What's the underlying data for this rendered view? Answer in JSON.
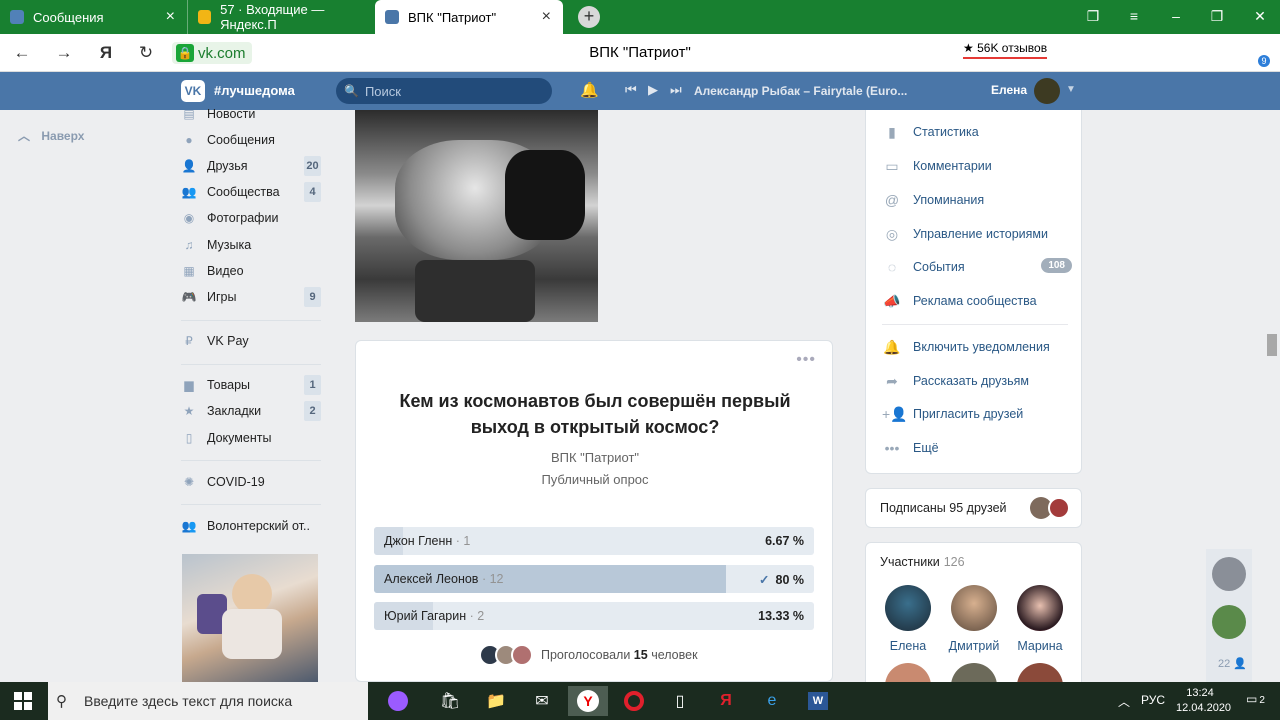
{
  "browser": {
    "tabs": [
      {
        "label": "Сообщения",
        "icon": "vk-messages-icon"
      },
      {
        "label": "57 · Входящие — Яндекс.П",
        "icon": "yandex-mail-icon"
      },
      {
        "label": "ВПК \"Патриот\"",
        "icon": "vk-icon"
      }
    ],
    "new_tab": "+",
    "url": "vk.com",
    "page_title": "ВПК \"Патриот\"",
    "reviews": "★ 56K отзывов",
    "yandex_glyph": "Я",
    "badge_downloads": "9"
  },
  "vk": {
    "hashtag": "#лучшедома",
    "search_placeholder": "Поиск",
    "track": "Александр Рыбак – Fairytale (Euro...",
    "user_name": "Елена",
    "back_to_top": "Наверх"
  },
  "left_nav": [
    {
      "label": "Новости",
      "icon": "news-icon",
      "count": ""
    },
    {
      "label": "Сообщения",
      "icon": "messages-icon",
      "count": ""
    },
    {
      "label": "Друзья",
      "icon": "friends-icon",
      "count": "20"
    },
    {
      "label": "Сообщества",
      "icon": "communities-icon",
      "count": "4"
    },
    {
      "label": "Фотографии",
      "icon": "camera-icon",
      "count": ""
    },
    {
      "label": "Музыка",
      "icon": "music-icon",
      "count": ""
    },
    {
      "label": "Видео",
      "icon": "video-icon",
      "count": ""
    },
    {
      "label": "Игры",
      "icon": "games-icon",
      "count": "9"
    },
    {
      "label": "VK Pay",
      "icon": "vkpay-icon",
      "count": ""
    },
    {
      "label": "Товары",
      "icon": "bag-icon",
      "count": "1"
    },
    {
      "label": "Закладки",
      "icon": "star-icon",
      "count": "2"
    },
    {
      "label": "Документы",
      "icon": "document-icon",
      "count": ""
    },
    {
      "label": "COVID-19",
      "icon": "virus-icon",
      "count": ""
    },
    {
      "label": "Волонтерский от..",
      "icon": "group-icon",
      "count": ""
    }
  ],
  "poll": {
    "question": "Кем из космонавтов был совершён первый выход в открытый космос?",
    "author": "ВПК \"Патриот\"",
    "type": "Публичный опрос",
    "options": [
      {
        "label": "Джон Гленн",
        "count": "· 1",
        "percent": "6.67 %",
        "fraction": 0.0667,
        "selected": false,
        "check": ""
      },
      {
        "label": "Алексей Леонов",
        "count": "· 12",
        "percent": "80 %",
        "fraction": 0.8,
        "selected": true,
        "check": "✓"
      },
      {
        "label": "Юрий Гагарин",
        "count": "· 2",
        "percent": "13.33 %",
        "fraction": 0.1333,
        "selected": false,
        "check": ""
      }
    ],
    "voted_prefix": "Проголосовали",
    "voted_count": "15",
    "voted_suffix": "человек"
  },
  "right_menu": [
    {
      "label": "Статистика",
      "icon": "stats-icon",
      "badge": ""
    },
    {
      "label": "Комментарии",
      "icon": "comment-icon",
      "badge": ""
    },
    {
      "label": "Упоминания",
      "icon": "at-icon",
      "badge": ""
    },
    {
      "label": "Управление историями",
      "icon": "stories-icon",
      "badge": ""
    },
    {
      "label": "События",
      "icon": "events-icon",
      "badge": "108"
    },
    {
      "label": "Реклама сообщества",
      "icon": "megaphone-icon",
      "badge": ""
    },
    {
      "label": "Включить уведомления",
      "icon": "bell-icon",
      "badge": ""
    },
    {
      "label": "Рассказать друзьям",
      "icon": "share-icon",
      "badge": ""
    },
    {
      "label": "Пригласить друзей",
      "icon": "invite-icon",
      "badge": ""
    },
    {
      "label": "Ещё",
      "icon": "more-icon",
      "badge": ""
    }
  ],
  "friends_box": {
    "label": "Подписаны 95 друзей"
  },
  "members": {
    "title": "Участники",
    "count": "126",
    "people": [
      {
        "name": "Елена"
      },
      {
        "name": "Дмитрий"
      },
      {
        "name": "Марина"
      }
    ]
  },
  "right_bar": {
    "count": "22"
  },
  "taskbar": {
    "search_placeholder": "Введите здесь текст для поиска",
    "lang": "РУС",
    "time": "13:24",
    "date": "12.04.2020",
    "notifications": "2"
  }
}
